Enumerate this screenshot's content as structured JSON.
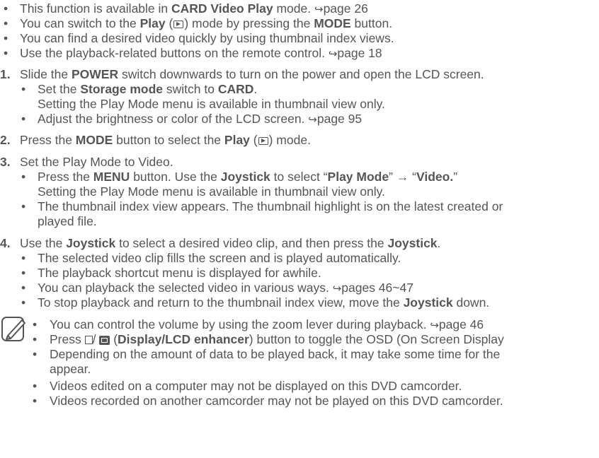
{
  "bullets": [
    {
      "pre": "This function is available in ",
      "bold": "CARD Video Play",
      "post": " mode. ",
      "ref": "page 26"
    },
    {
      "pre": "You can switch to the ",
      "bold": "Play",
      "mid": " (",
      "mid2": ") mode by pressing the ",
      "bold2": "MODE",
      "post": " button."
    },
    {
      "text": "You can find a desired video quickly by using thumbnail index views."
    },
    {
      "pre": "Use the playback-related buttons on the remote control. ",
      "ref": "page 18"
    }
  ],
  "steps": {
    "s1": {
      "num": "1.",
      "pre": "Slide the ",
      "bold": "POWER",
      "post": " switch downwards to turn on the power and open the LCD screen.",
      "sub1_pre": "Set the ",
      "sub1_bold": "Storage mode",
      "sub1_mid": " switch to ",
      "sub1_bold2": "CARD",
      "sub1_post": ".",
      "sub1_cont": "Setting the Play Mode menu is available in thumbnail view only.",
      "sub2": "Adjust the brightness or color of the LCD screen. ",
      "sub2_ref": "page 95"
    },
    "s2": {
      "num": "2.",
      "pre": "Press the ",
      "bold": "MODE",
      "mid": " button to select the ",
      "bold2": "Play",
      "mid2": " (",
      "post": ") mode."
    },
    "s3": {
      "num": "3.",
      "text": "Set the Play Mode to Video.",
      "sub1_pre": "Press the ",
      "sub1_bold": "MENU",
      "sub1_mid": " button. Use the ",
      "sub1_bold2": "Joystick",
      "sub1_mid2": " to select “",
      "sub1_bold3": "Play Mode",
      "sub1_mid3": "” → “",
      "sub1_bold4": "Video.",
      "sub1_post": "”",
      "sub1_cont": "Setting the Play Mode menu is available in thumbnail view only.",
      "sub2": "The thumbnail index view appears. The thumbnail highlight is on the latest created or",
      "sub2_cont": "played file."
    },
    "s4": {
      "num": "4.",
      "pre": "Use the ",
      "bold": "Joystick",
      "mid": " to select a desired video clip, and then press the ",
      "bold2": "Joystick",
      "post": ".",
      "sub1": "The selected video clip fills the screen and is played automatically.",
      "sub2": "The playback shortcut menu is displayed for awhile.",
      "sub3": "You can playback the selected video in various ways. ",
      "sub3_ref": "pages 46~47",
      "sub4_pre": "To stop playback and return to the thumbnail index view, move the ",
      "sub4_bold": "Joystick",
      "sub4_post": " down."
    }
  },
  "notes": {
    "n1": "You can control the volume by using the zoom lever during playback. ",
    "n1_ref": "page 46",
    "n2_pre": "Press ",
    "n2_sep": "/ ",
    "n2_mid": " (",
    "n2_bold": "Display/LCD enhancer",
    "n2_post": ") button to toggle the OSD (On Screen Display",
    "n3": "Depending on the amount of data to be played back, it may take some time for the",
    "n3_cont": "appear.",
    "n4": "Videos edited on a computer may not be displayed on this DVD camcorder.",
    "n5": "Videos recorded on another camcorder may not be played on this DVD camcorder."
  },
  "symbols": {
    "bullet": "•",
    "page_arrow": "↪"
  },
  "icons": [
    "play-mode-icon",
    "note-icon",
    "display-icon",
    "lcd-enhancer-icon",
    "page-reference-arrow-icon"
  ]
}
